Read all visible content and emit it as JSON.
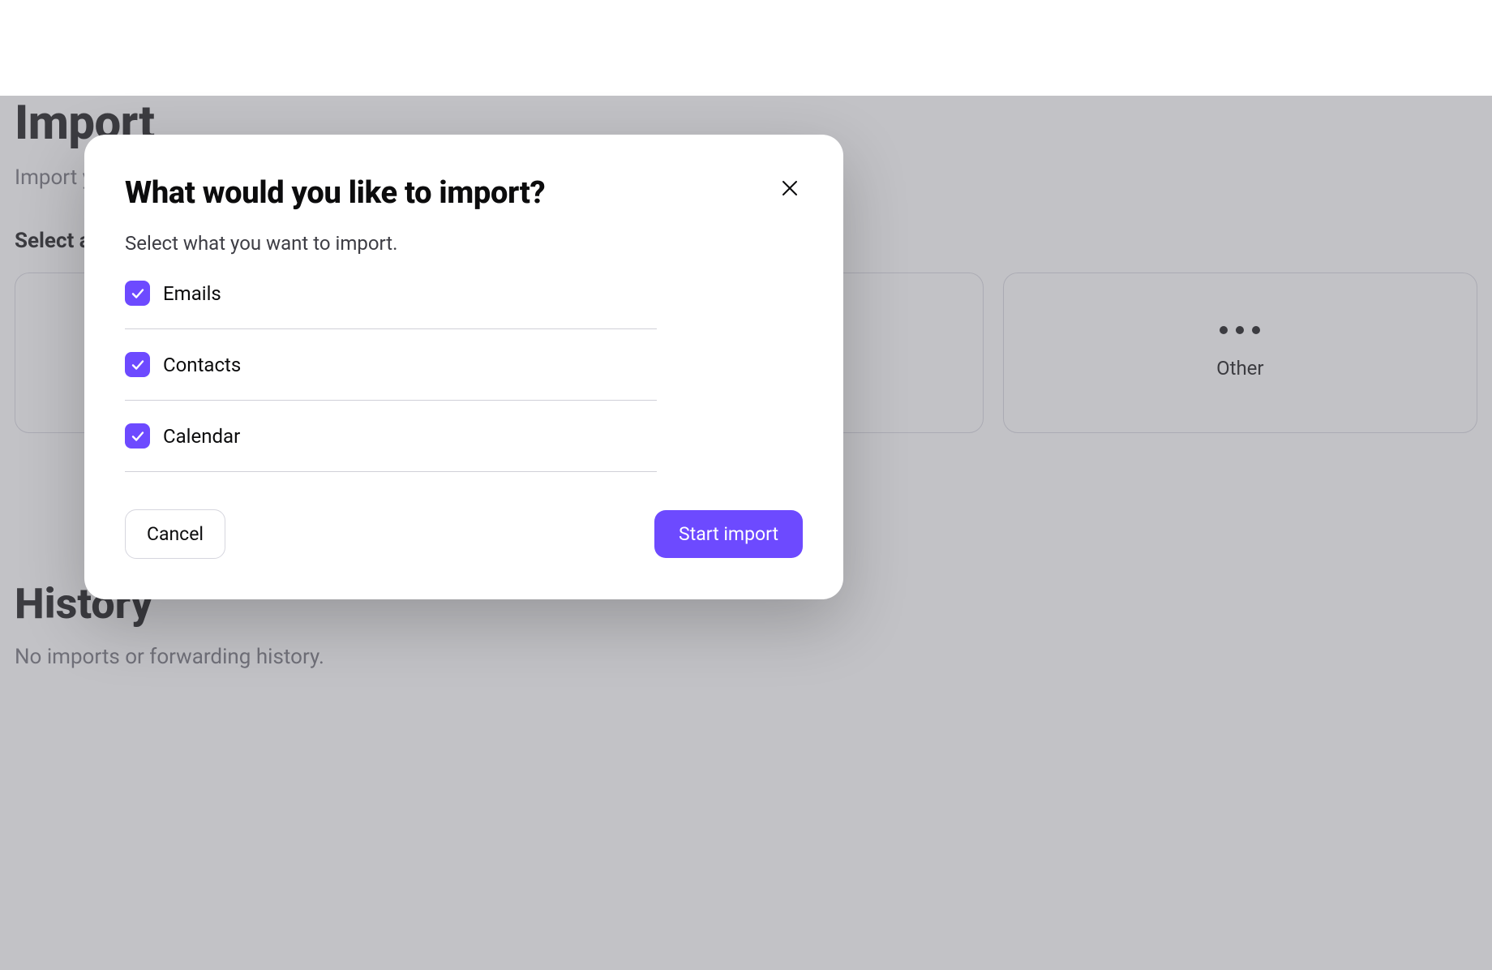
{
  "page": {
    "title": "Import",
    "subtitle": "Import your data",
    "select_label": "Select a",
    "provider_other": "Other",
    "history_title": "History",
    "history_empty": "No imports or forwarding history."
  },
  "modal": {
    "title": "What would you like to import?",
    "subtitle": "Select what you want to import.",
    "options": [
      {
        "label": "Emails",
        "checked": true
      },
      {
        "label": "Contacts",
        "checked": true
      },
      {
        "label": "Calendar",
        "checked": true
      }
    ],
    "cancel_label": "Cancel",
    "start_label": "Start import"
  },
  "colors": {
    "accent": "#6d4aff"
  }
}
